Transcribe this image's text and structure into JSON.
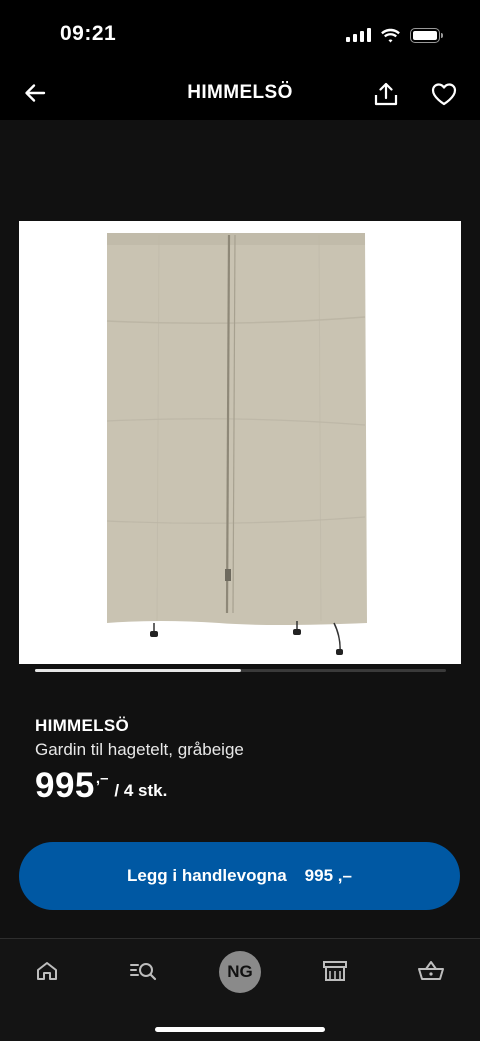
{
  "status_bar": {
    "time": "09:21"
  },
  "header": {
    "title": "HIMMELSÖ"
  },
  "product": {
    "name": "HIMMELSÖ",
    "description": "Gardin til hagetelt, gråbeige",
    "price_int": "995",
    "price_dec": ",–",
    "price_unit": "/ 4 stk.",
    "fabric_color": "#c9c3b2"
  },
  "carousel": {
    "progress": 0.5
  },
  "cart_button": {
    "label": "Legg i handlevogna",
    "price": "995 ,–"
  },
  "bottom_nav": {
    "avatar_initials": "NG",
    "items": [
      "home-icon",
      "search-icon",
      "profile-avatar",
      "store-icon",
      "basket-icon"
    ]
  },
  "colors": {
    "accent": "#0058a3",
    "background": "#111111"
  }
}
